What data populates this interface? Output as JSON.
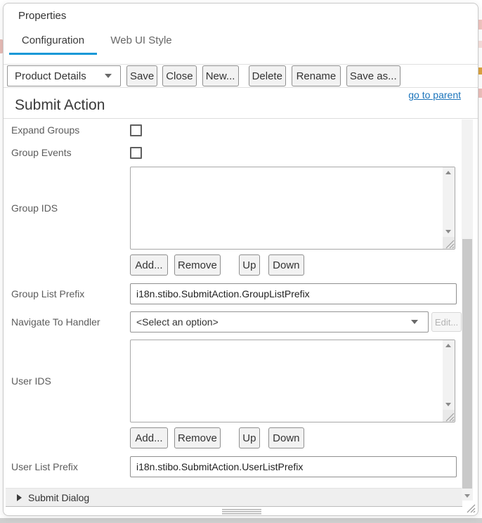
{
  "colors": {
    "accent": "#1798d7",
    "link": "#1b74bb"
  },
  "window": {
    "title": "Properties"
  },
  "tabs": [
    {
      "label": "Configuration",
      "active": true
    },
    {
      "label": "Web UI Style",
      "active": false
    }
  ],
  "toolbar": {
    "config_select": {
      "value": "Product Details"
    },
    "buttons": [
      "Save",
      "Close",
      "New...",
      "Delete",
      "Rename",
      "Save as..."
    ]
  },
  "links": {
    "go_to_parent": "go to parent"
  },
  "section": {
    "heading": "Submit Action"
  },
  "form": {
    "expand_groups": {
      "label": "Expand Groups",
      "checked": false
    },
    "group_events": {
      "label": "Group Events",
      "checked": false
    },
    "group_ids": {
      "label": "Group IDS",
      "value": ""
    },
    "group_ids_buttons": [
      "Add...",
      "Remove",
      "Up",
      "Down"
    ],
    "group_list_prefix": {
      "label": "Group List Prefix",
      "value": "i18n.stibo.SubmitAction.GroupListPrefix"
    },
    "navigate_to_handler": {
      "label": "Navigate To Handler",
      "selected": "<Select an option>",
      "edit_label": "Edit..."
    },
    "user_ids": {
      "label": "User IDS",
      "value": ""
    },
    "user_ids_buttons": [
      "Add...",
      "Remove",
      "Up",
      "Down"
    ],
    "user_list_prefix": {
      "label": "User List Prefix",
      "value": "i18n.stibo.SubmitAction.UserListPrefix"
    }
  },
  "collapsed_sections": [
    {
      "label": "Submit Dialog"
    }
  ],
  "icons": {
    "chevron-down-icon": "css-triangle-down",
    "expand-arrow-icon": "css-triangle-right",
    "scroll-up-icon": "css-triangle-up",
    "scroll-down-icon": "css-triangle-down",
    "resize-grip-icon": "svg-diagonal-lines",
    "drag-handle-icon": "css-horizontal-lines"
  }
}
